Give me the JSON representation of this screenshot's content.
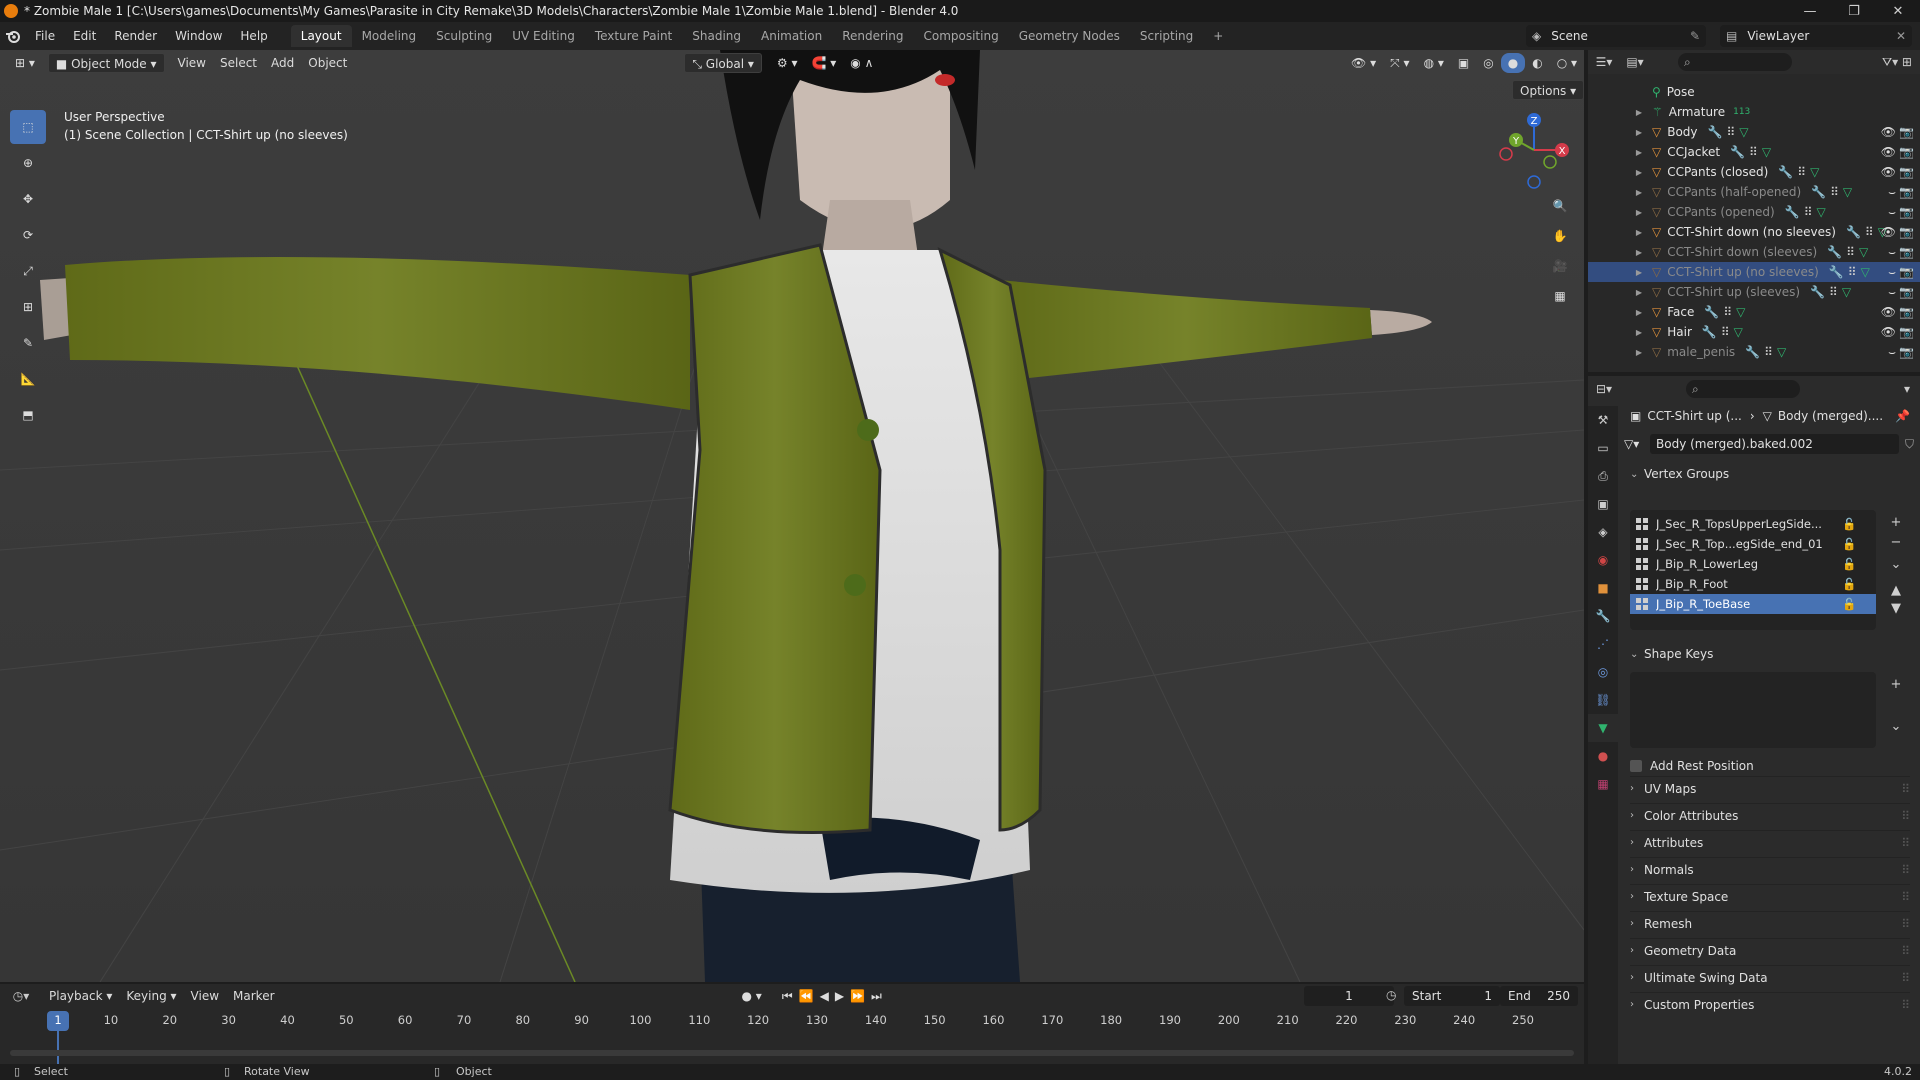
{
  "window": {
    "title": "* Zombie Male 1 [C:\\Users\\games\\Documents\\My Games\\Parasite in City Remake\\3D Models\\Characters\\Zombie Male 1\\Zombie Male 1.blend] - Blender 4.0",
    "controls": {
      "minimize": "—",
      "maximize": "❐",
      "close": "✕"
    }
  },
  "menu": [
    "File",
    "Edit",
    "Render",
    "Window",
    "Help"
  ],
  "workspaces": [
    "Layout",
    "Modeling",
    "Sculpting",
    "UV Editing",
    "Texture Paint",
    "Shading",
    "Animation",
    "Rendering",
    "Compositing",
    "Geometry Nodes",
    "Scripting",
    "+"
  ],
  "active_workspace": "Layout",
  "scene": {
    "name": "Scene",
    "view_layer": "ViewLayer"
  },
  "viewport": {
    "mode": "Object Mode",
    "menus": [
      "View",
      "Select",
      "Add",
      "Object"
    ],
    "transform_orientation": "Global",
    "options_label": "Options",
    "overlay_line1": "User Perspective",
    "overlay_line2": "(1) Scene Collection | CCT-Shirt up (no sleeves)",
    "gizmo": {
      "z": "Z",
      "y": "Y",
      "x": "X"
    }
  },
  "outliner": {
    "rows": [
      {
        "name": "Pose",
        "selected": false,
        "dim": false,
        "type": "pose"
      },
      {
        "name": "Armature",
        "badge": "113",
        "selected": false,
        "dim": false,
        "type": "armature"
      },
      {
        "name": "Body",
        "selected": false,
        "dim": false,
        "type": "mesh"
      },
      {
        "name": "CCJacket",
        "selected": false,
        "dim": false,
        "type": "mesh"
      },
      {
        "name": "CCPants (closed)",
        "selected": false,
        "dim": false,
        "type": "mesh"
      },
      {
        "name": "CCPants (half-opened)",
        "selected": false,
        "dim": true,
        "type": "mesh"
      },
      {
        "name": "CCPants (opened)",
        "selected": false,
        "dim": true,
        "type": "mesh"
      },
      {
        "name": "CCT-Shirt down (no sleeves)",
        "selected": false,
        "dim": false,
        "type": "mesh"
      },
      {
        "name": "CCT-Shirt down (sleeves)",
        "selected": false,
        "dim": true,
        "type": "mesh"
      },
      {
        "name": "CCT-Shirt up (no sleeves)",
        "selected": true,
        "dim": true,
        "type": "mesh"
      },
      {
        "name": "CCT-Shirt up (sleeves)",
        "selected": false,
        "dim": true,
        "type": "mesh"
      },
      {
        "name": "Face",
        "selected": false,
        "dim": false,
        "type": "mesh"
      },
      {
        "name": "Hair",
        "selected": false,
        "dim": false,
        "type": "mesh"
      },
      {
        "name": "male_penis",
        "selected": false,
        "dim": true,
        "type": "mesh"
      }
    ]
  },
  "properties": {
    "breadcrumb_object": "CCT-Shirt up (...",
    "breadcrumb_data": "Body (merged)....",
    "mesh_name": "Body (merged).baked.002",
    "vertex_groups_label": "Vertex Groups",
    "vertex_groups": [
      {
        "name": "J_Sec_R_TopsUpperLegSide...",
        "selected": false
      },
      {
        "name": "J_Sec_R_Top...egSide_end_01",
        "selected": false
      },
      {
        "name": "J_Bip_R_LowerLeg",
        "selected": false
      },
      {
        "name": "J_Bip_R_Foot",
        "selected": false
      },
      {
        "name": "J_Bip_R_ToeBase",
        "selected": true
      }
    ],
    "shape_keys_label": "Shape Keys",
    "add_rest_position_label": "Add Rest Position",
    "panels": [
      "UV Maps",
      "Color Attributes",
      "Attributes",
      "Normals",
      "Texture Space",
      "Remesh",
      "Geometry Data",
      "Ultimate Swing Data",
      "Custom Properties"
    ]
  },
  "timeline": {
    "menus": [
      "Playback",
      "Keying",
      "View",
      "Marker"
    ],
    "current_frame": "1",
    "start_label": "Start",
    "start": "1",
    "end_label": "End",
    "end": "250",
    "ruler": [
      "1",
      "10",
      "20",
      "30",
      "40",
      "50",
      "60",
      "70",
      "80",
      "90",
      "100",
      "110",
      "120",
      "130",
      "140",
      "150",
      "160",
      "170",
      "180",
      "190",
      "200",
      "210",
      "220",
      "230",
      "240",
      "250"
    ]
  },
  "statusbar": {
    "left": "Select",
    "middle": "Rotate View",
    "right": "Object",
    "version": "4.0.2"
  },
  "colors": {
    "accent": "#4772b3",
    "selection_outliner": "#334d80",
    "jacket": "#6d7a1f",
    "mesh_icon": "#e0913b",
    "modifier_icon": "#6e9be0",
    "vgroup_icon": "#30b36e"
  }
}
